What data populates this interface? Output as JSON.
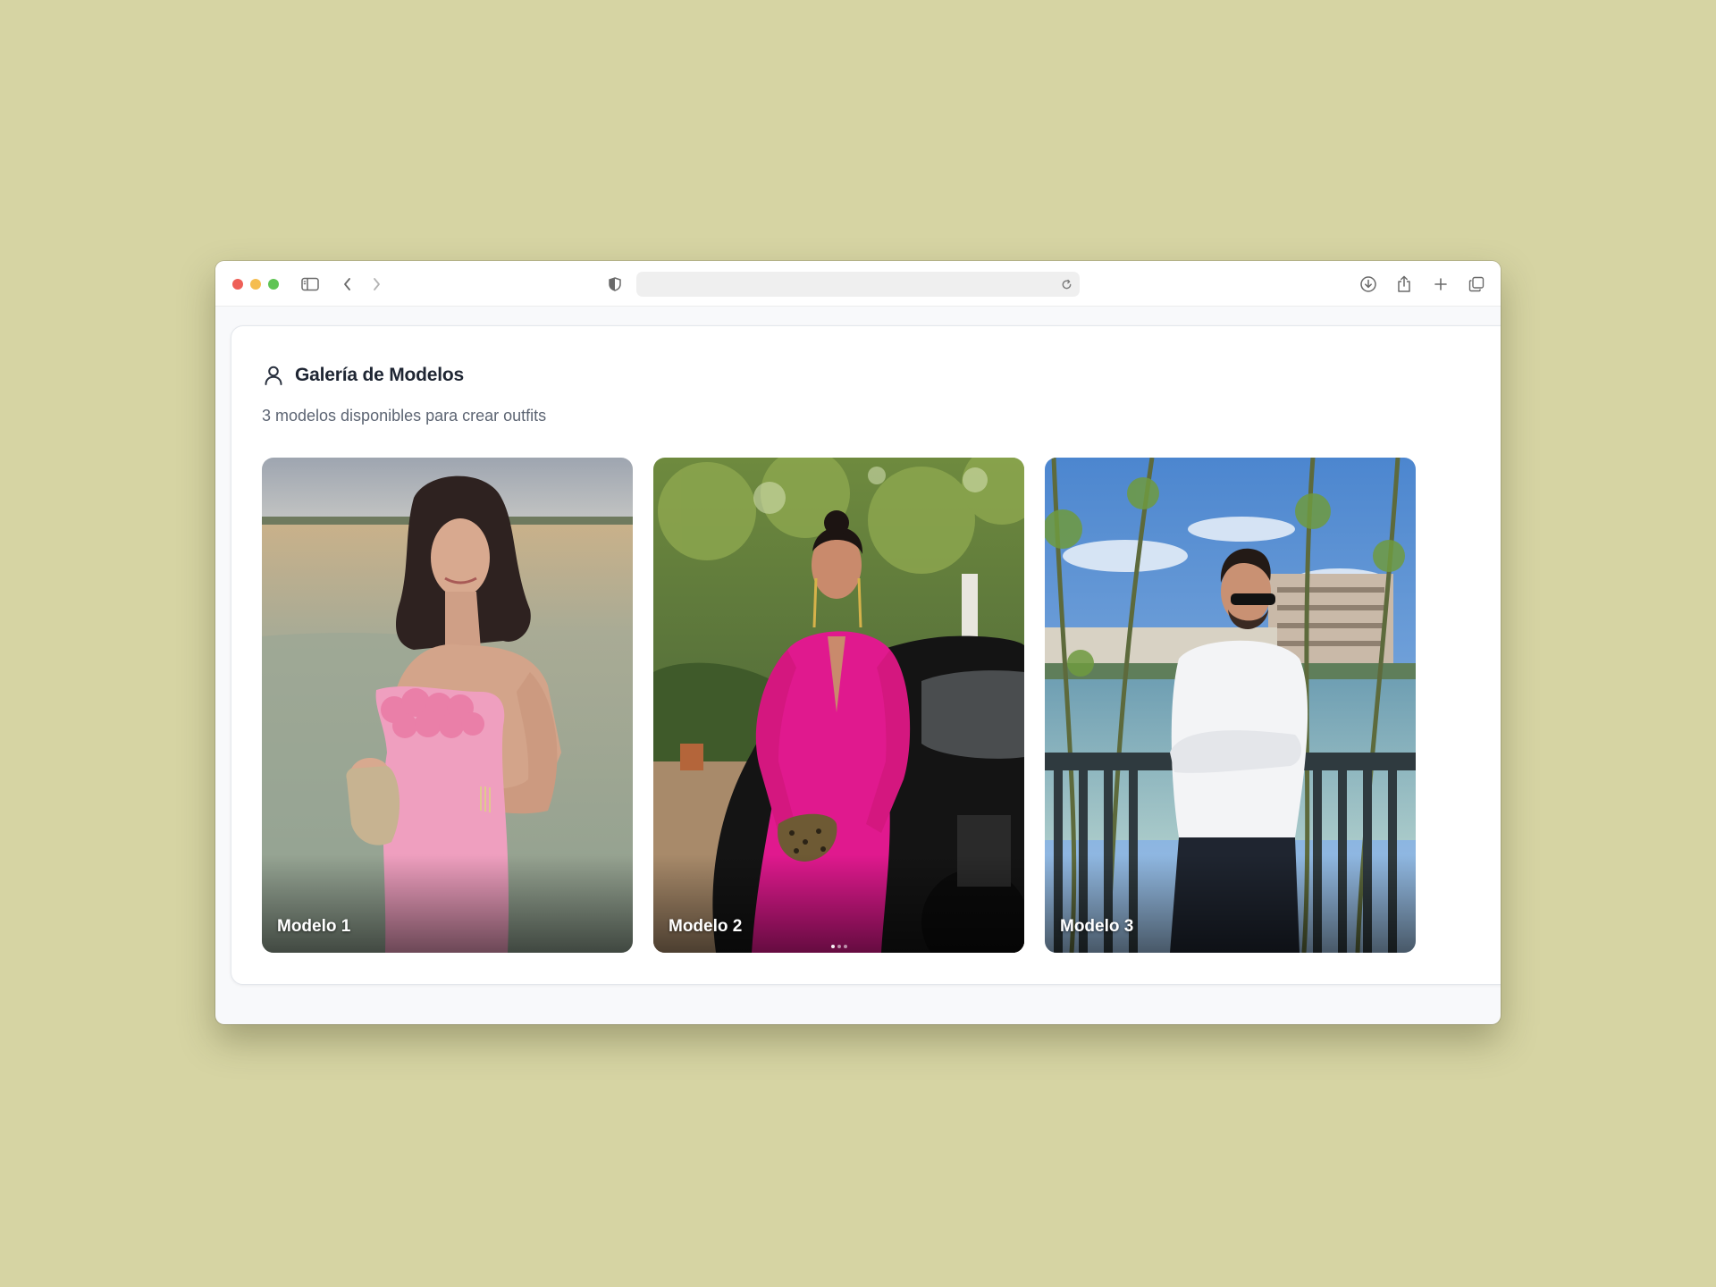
{
  "browser": {
    "address_value": "",
    "icons": [
      "sidebar-icon",
      "back-icon",
      "forward-icon",
      "shield-icon",
      "reload-icon",
      "download-icon",
      "share-icon",
      "new-tab-icon",
      "tabs-overview-icon"
    ]
  },
  "gallery": {
    "title": "Galería de Modelos",
    "subtitle": "3 modelos disponibles para crear outfits",
    "header_icon": "user-icon",
    "models": [
      {
        "label": "Modelo 1"
      },
      {
        "label": "Modelo 2"
      },
      {
        "label": "Modelo 3"
      }
    ]
  },
  "colors": {
    "desktop": "#d6d4a3",
    "title": "#1f2633",
    "subtitle": "#5d6573"
  }
}
